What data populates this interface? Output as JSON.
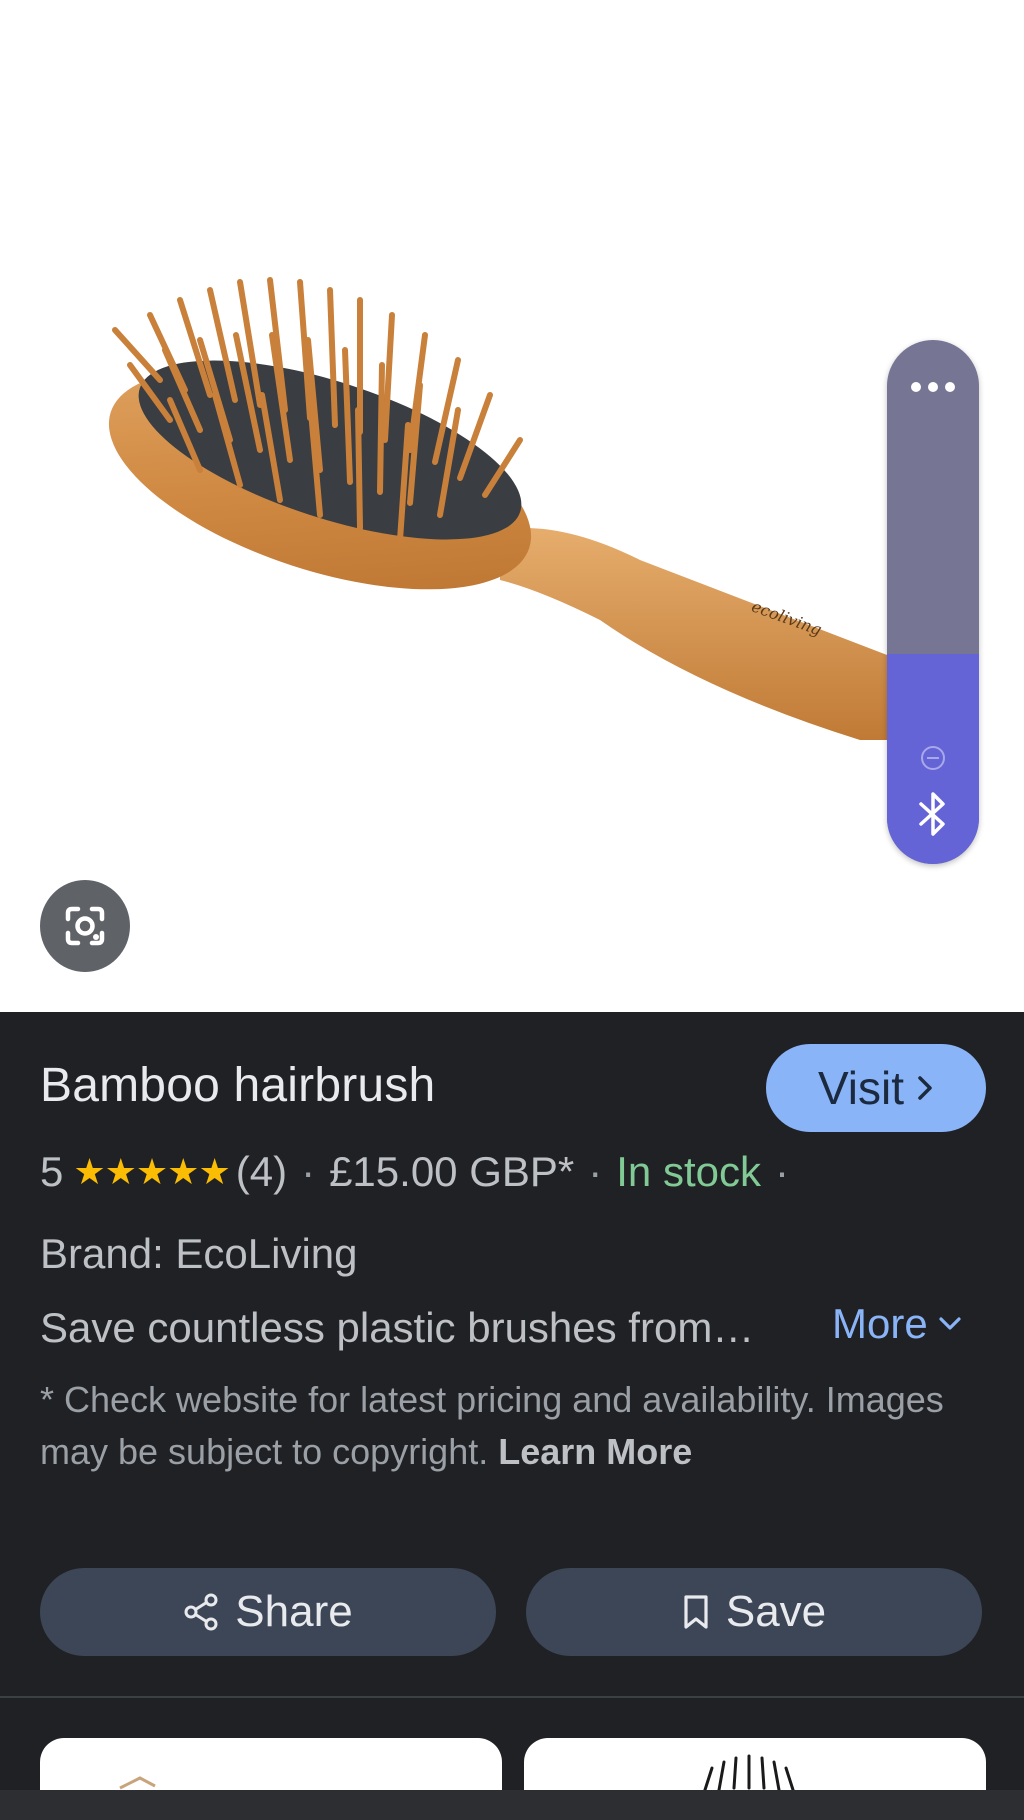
{
  "product": {
    "title": "Bamboo hairbrush",
    "rating_value": "5",
    "stars": "★★★★★",
    "review_count": "(4)",
    "separator": "·",
    "price": "£15.00 GBP*",
    "stock_status": "In stock",
    "brand": "Brand: EcoLiving",
    "description": "Save countless plastic brushes from…",
    "image_logo_text": "ecoliving"
  },
  "actions": {
    "visit_label": "Visit",
    "more_label": "More",
    "share_label": "Share",
    "save_label": "Save"
  },
  "disclaimer": {
    "text": "* Check website for latest pricing and availability. Images may be subject to copyright.",
    "link_label": "Learn More"
  },
  "volume": {
    "level": 0.4
  },
  "icons": {
    "lens": "google-lens-icon",
    "more": "more-dots-icon",
    "mute": "mute-icon",
    "bluetooth": "bluetooth-icon",
    "visit_chevron": "chevron-right-icon",
    "more_chevron": "chevron-down-icon",
    "share": "share-icon",
    "save": "bookmark-icon"
  },
  "colors": {
    "panel_bg": "#202124",
    "accent_blue": "#8ab4f8",
    "stock_green": "#81c995",
    "star_yellow": "#fbbc04",
    "button_bg": "#3c4656",
    "volume_track": "#777594",
    "volume_fill": "#6464d6"
  }
}
